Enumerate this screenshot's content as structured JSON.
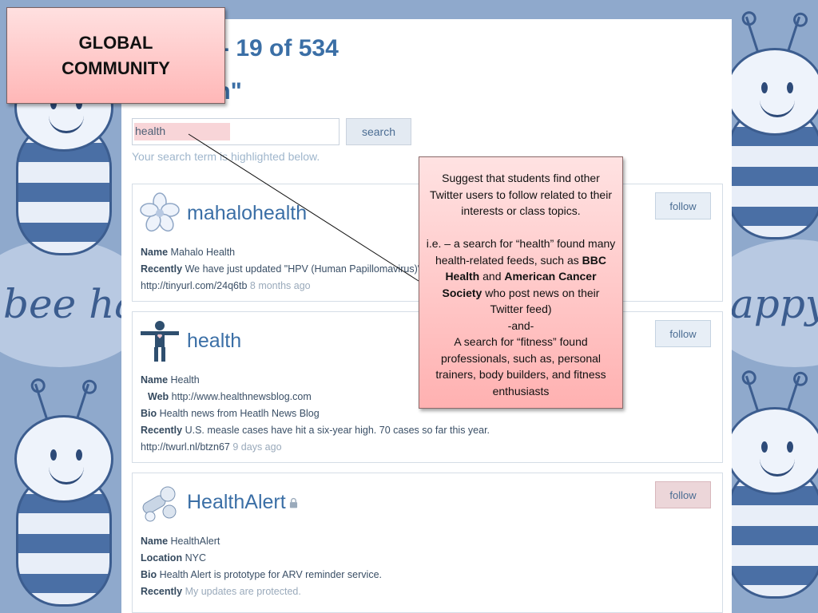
{
  "title_box": {
    "line1": "GLOBAL",
    "line2": "COMMUNITY"
  },
  "header": {
    "results_count": "1 - 19 of 534",
    "query_fragment": "lth\""
  },
  "search": {
    "value": "health",
    "button_label": "search",
    "hint": "Your search term is highlighted below."
  },
  "results": [
    {
      "screen_name": "mahalohealth",
      "follow_label": "follow",
      "fields": [
        {
          "label": "Name",
          "value": "Mahalo Health"
        },
        {
          "label": "Recently",
          "value": "We have just updated \"HPV (Human Papillomavirus)\""
        },
        {
          "label": "",
          "value": "http://tinyurl.com/24q6tb",
          "meta": "8 months ago"
        }
      ]
    },
    {
      "screen_name": "health",
      "follow_label": "follow",
      "fields": [
        {
          "label": "Name",
          "value": "Health"
        },
        {
          "label": "Web",
          "value": "http://www.healthnewsblog.com"
        },
        {
          "label": "Bio",
          "value": "Health news from Heatlh News Blog"
        },
        {
          "label": "Recently",
          "value": "U.S. measle cases have hit a six-year high. 70 cases so far this year."
        },
        {
          "label": "",
          "value": "http://twurl.nl/btzn67",
          "meta": "9 days ago"
        }
      ]
    },
    {
      "screen_name": "HealthAlert",
      "follow_label": "follow",
      "fields": [
        {
          "label": "Name",
          "value": "HealthAlert"
        },
        {
          "label": "Location",
          "value": "NYC"
        },
        {
          "label": "Bio",
          "value": "Health Alert is prototype for ARV reminder service."
        },
        {
          "label": "Recently",
          "value": "",
          "meta": "My updates are protected."
        }
      ]
    }
  ],
  "note": {
    "para1": "Suggest that students find other Twitter users to follow related to their interests or class topics.",
    "para2_pre": "i.e. – a search for “health” found many health-related feeds, such as ",
    "para2_bold1": "BBC Health",
    "para2_mid": " and ",
    "para2_bold2": "American Cancer Society",
    "para2_post": " who post news on their Twitter feed)",
    "and_line": "-and-",
    "para3": "A search for “fitness” found professionals, such as, personal trainers, body builders, and fitness enthusiasts"
  },
  "background_text": {
    "left": "bee happ",
    "right": "appy"
  },
  "icons": {
    "avatar1": "flower-icon",
    "avatar2": "person-figure-icon",
    "avatar3": "pills-icon",
    "lock": "lock-icon"
  },
  "colors": {
    "accent_blue": "#3b6fa6",
    "callout_pink": "#ffb7b7",
    "background_blue": "#8fa9cc"
  }
}
